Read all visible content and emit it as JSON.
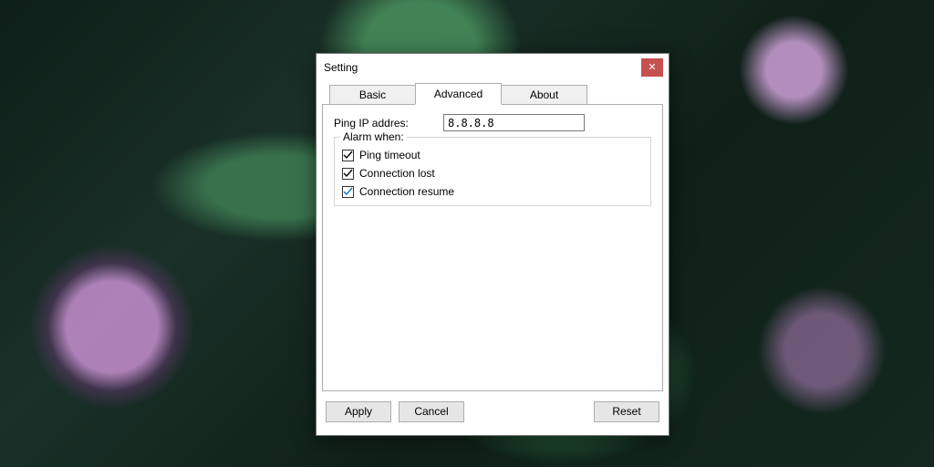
{
  "window": {
    "title": "Setting"
  },
  "tabs": {
    "basic": "Basic",
    "advanced": "Advanced",
    "about": "About",
    "active": "advanced"
  },
  "advanced": {
    "ping_ip_label": "Ping IP addres:",
    "ping_ip_value": "8.8.8.8",
    "alarm_group_title": "Alarm when:",
    "checks": {
      "ping_timeout": {
        "label": "Ping timeout",
        "checked": true,
        "color": "#000"
      },
      "connection_lost": {
        "label": "Connection lost",
        "checked": true,
        "color": "#000"
      },
      "connection_resume": {
        "label": "Connection resume",
        "checked": true,
        "color": "#0078d7"
      }
    }
  },
  "buttons": {
    "apply": "Apply",
    "cancel": "Cancel",
    "reset": "Reset"
  }
}
